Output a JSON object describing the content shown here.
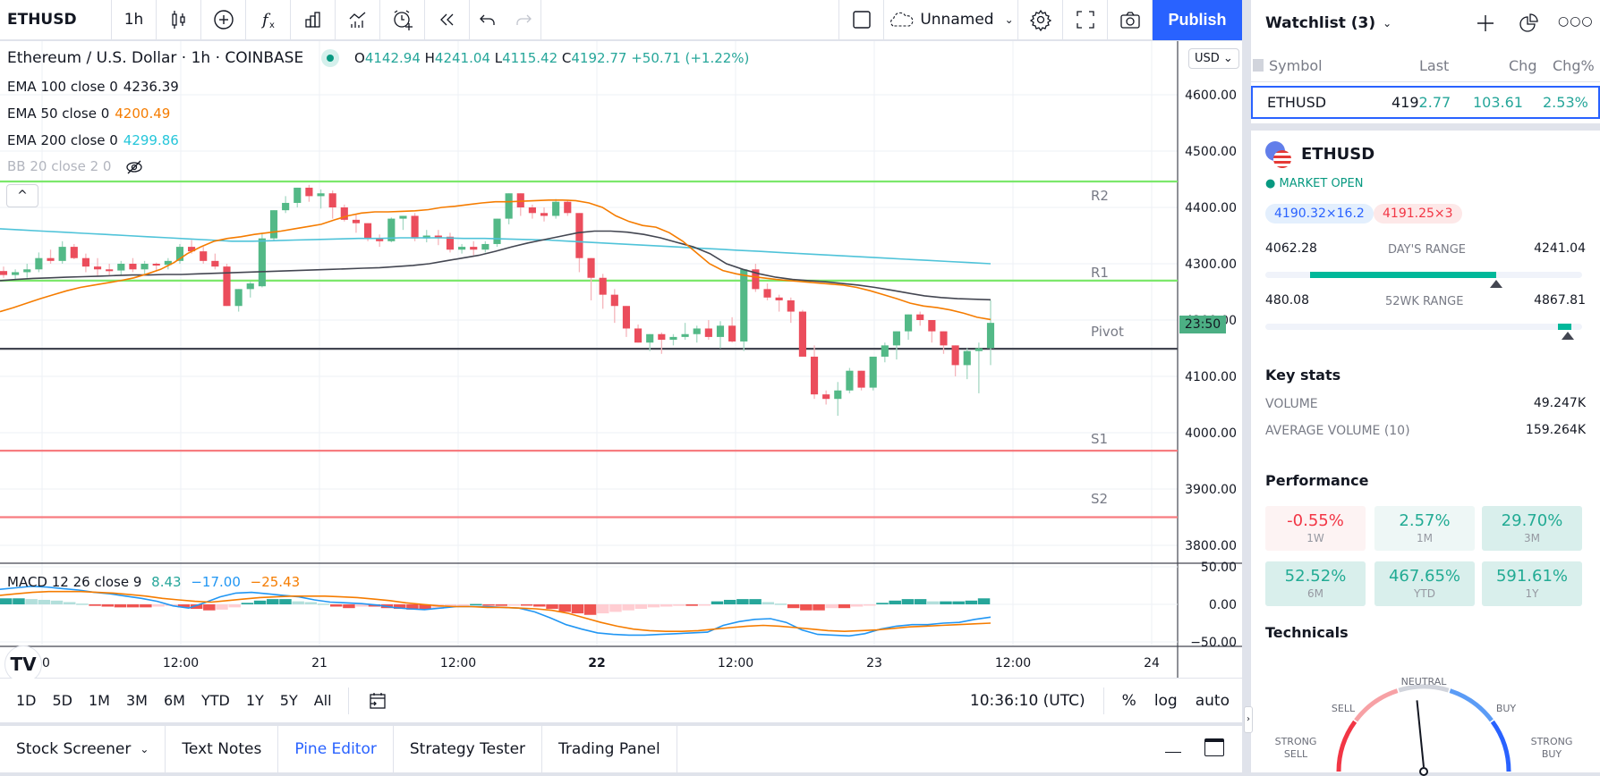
{
  "toolbar": {
    "symbol": "ETHUSD",
    "interval": "1h",
    "layout_name": "Unnamed",
    "publish_label": "Publish"
  },
  "chart": {
    "title": "Ethereum / U.S. Dollar · 1h · COINBASE",
    "ohlc": {
      "o_label": "O",
      "o": "4142.94",
      "h_label": "H",
      "h": "4241.04",
      "l_label": "L",
      "l": "4115.42",
      "c_label": "C",
      "c": "4192.77",
      "change": "+50.71 (+1.22%)"
    },
    "indicators": [
      {
        "label": "EMA 100 close 0",
        "value": "4236.39",
        "color": "#131722"
      },
      {
        "label": "EMA 50 close 0",
        "value": "4200.49",
        "color": "#f57c00"
      },
      {
        "label": "EMA 200 close 0",
        "value": "4299.86",
        "color": "#26c6da"
      },
      {
        "label": "BB 20 close 2 0",
        "value": "",
        "color": "#b2b5be"
      }
    ],
    "currency": "USD",
    "countdown": "23:50",
    "macd_label": "MACD 12 26 close 9",
    "macd_values": [
      "8.43",
      "−17.00",
      "−25.43"
    ],
    "pivots": {
      "R2": 4446,
      "R1": 4270,
      "Pivot": 4149,
      "S1": 3968,
      "S2": 3850
    },
    "pivot_labels": [
      "R2",
      "R1",
      "Pivot",
      "S1",
      "S2"
    ],
    "collapse_icon": "^",
    "logo": "TV"
  },
  "chart_data": {
    "type": "candlestick",
    "title": "Ethereum / U.S. Dollar · 1h · COINBASE",
    "y_ticks": [
      "4600.00",
      "4500.00",
      "4400.00",
      "4300.00",
      "4200.00",
      "4100.00",
      "4000.00",
      "3900.00",
      "3800.00"
    ],
    "ylim": [
      3770,
      4680
    ],
    "x_ticks": [
      "20",
      "12:00",
      "21",
      "12:00",
      "22",
      "12:00",
      "23",
      "12:00",
      "24"
    ],
    "macd_ticks": [
      "50.00",
      "0.00",
      "−50.00"
    ],
    "macd_ylim": [
      -60,
      60
    ],
    "candles": [
      [
        4287,
        4295,
        4275,
        4280
      ],
      [
        4280,
        4290,
        4272,
        4285
      ],
      [
        4285,
        4300,
        4275,
        4290
      ],
      [
        4290,
        4320,
        4285,
        4310
      ],
      [
        4310,
        4325,
        4300,
        4305
      ],
      [
        4305,
        4340,
        4300,
        4330
      ],
      [
        4330,
        4335,
        4308,
        4310
      ],
      [
        4310,
        4318,
        4285,
        4295
      ],
      [
        4295,
        4310,
        4278,
        4290
      ],
      [
        4290,
        4300,
        4280,
        4288
      ],
      [
        4288,
        4305,
        4280,
        4300
      ],
      [
        4300,
        4310,
        4285,
        4290
      ],
      [
        4290,
        4305,
        4282,
        4300
      ],
      [
        4300,
        4302,
        4288,
        4298
      ],
      [
        4298,
        4310,
        4290,
        4305
      ],
      [
        4305,
        4335,
        4300,
        4330
      ],
      [
        4330,
        4342,
        4318,
        4322
      ],
      [
        4322,
        4330,
        4300,
        4305
      ],
      [
        4305,
        4318,
        4290,
        4295
      ],
      [
        4295,
        4300,
        4225,
        4225
      ],
      [
        4225,
        4250,
        4215,
        4255
      ],
      [
        4255,
        4268,
        4240,
        4265
      ],
      [
        4260,
        4355,
        4258,
        4345
      ],
      [
        4345,
        4395,
        4340,
        4395
      ],
      [
        4395,
        4420,
        4390,
        4408
      ],
      [
        4408,
        4428,
        4400,
        4435
      ],
      [
        4435,
        4440,
        4410,
        4420
      ],
      [
        4420,
        4432,
        4398,
        4425
      ],
      [
        4425,
        4430,
        4380,
        4400
      ],
      [
        4400,
        4405,
        4375,
        4378
      ],
      [
        4378,
        4388,
        4355,
        4372
      ],
      [
        4372,
        4365,
        4340,
        4345
      ],
      [
        4345,
        4352,
        4330,
        4340
      ],
      [
        4340,
        4382,
        4338,
        4380
      ],
      [
        4380,
        4385,
        4360,
        4385
      ],
      [
        4385,
        4390,
        4340,
        4345
      ],
      [
        4345,
        4360,
        4338,
        4350
      ],
      [
        4350,
        4360,
        4333,
        4348
      ],
      [
        4348,
        4355,
        4320,
        4325
      ],
      [
        4325,
        4335,
        4318,
        4330
      ],
      [
        4330,
        4340,
        4315,
        4325
      ],
      [
        4325,
        4340,
        4320,
        4335
      ],
      [
        4335,
        4380,
        4330,
        4380
      ],
      [
        4380,
        4425,
        4370,
        4425
      ],
      [
        4425,
        4425,
        4385,
        4400
      ],
      [
        4400,
        4405,
        4380,
        4390
      ],
      [
        4390,
        4400,
        4375,
        4385
      ],
      [
        4385,
        4415,
        4380,
        4410
      ],
      [
        4410,
        4412,
        4385,
        4390
      ],
      [
        4390,
        4365,
        4285,
        4310
      ],
      [
        4310,
        4300,
        4235,
        4275
      ],
      [
        4275,
        4282,
        4220,
        4245
      ],
      [
        4245,
        4255,
        4195,
        4225
      ],
      [
        4225,
        4225,
        4170,
        4185
      ],
      [
        4185,
        4192,
        4160,
        4160
      ],
      [
        4160,
        4175,
        4145,
        4175
      ],
      [
        4175,
        4178,
        4140,
        4165
      ],
      [
        4165,
        4175,
        4155,
        4170
      ],
      [
        4170,
        4195,
        4165,
        4175
      ],
      [
        4175,
        4190,
        4160,
        4185
      ],
      [
        4185,
        4200,
        4165,
        4170
      ],
      [
        4170,
        4198,
        4150,
        4190
      ],
      [
        4190,
        4205,
        4160,
        4162
      ],
      [
        4162,
        4290,
        4145,
        4290
      ],
      [
        4290,
        4300,
        4250,
        4255
      ],
      [
        4255,
        4265,
        4235,
        4240
      ],
      [
        4240,
        4245,
        4215,
        4235
      ],
      [
        4235,
        4240,
        4195,
        4215
      ],
      [
        4215,
        4218,
        4135,
        4135
      ],
      [
        4135,
        4155,
        4060,
        4068
      ],
      [
        4068,
        4075,
        4050,
        4060
      ],
      [
        4060,
        4090,
        4030,
        4075
      ],
      [
        4075,
        4115,
        4070,
        4110
      ],
      [
        4110,
        4110,
        4075,
        4080
      ],
      [
        4080,
        4135,
        4075,
        4135
      ],
      [
        4135,
        4160,
        4125,
        4155
      ],
      [
        4155,
        4175,
        4130,
        4180
      ],
      [
        4180,
        4210,
        4165,
        4210
      ],
      [
        4210,
        4215,
        4190,
        4200
      ],
      [
        4200,
        4188,
        4160,
        4180
      ],
      [
        4180,
        4178,
        4140,
        4155
      ],
      [
        4155,
        4148,
        4100,
        4120
      ],
      [
        4120,
        4150,
        4095,
        4145
      ],
      [
        4145,
        4160,
        4070,
        4150
      ],
      [
        4150,
        4235,
        4120,
        4195
      ]
    ],
    "ema50": [
      4215,
      4222,
      4230,
      4238,
      4245,
      4252,
      4258,
      4262,
      4266,
      4270,
      4275,
      4282,
      4290,
      4302,
      4318,
      4330,
      4340,
      4345,
      4348,
      4352,
      4355,
      4358,
      4362,
      4366,
      4370,
      4378,
      4385,
      4390,
      4392,
      4392,
      4393,
      4394,
      4396,
      4400,
      4402,
      4405,
      4408,
      4410,
      4410,
      4411,
      4412,
      4413,
      4413,
      4412,
      4408,
      4400,
      4385,
      4375,
      4368,
      4365,
      4355,
      4340,
      4320,
      4300,
      4288,
      4282,
      4278,
      4275,
      4272,
      4270,
      4268,
      4266,
      4264,
      4262,
      4258,
      4252,
      4245,
      4238,
      4230,
      4225,
      4222,
      4218,
      4212,
      4205,
      4201
    ],
    "ema100": [
      4270,
      4272,
      4274,
      4275,
      4276,
      4277,
      4278,
      4279,
      4280,
      4280,
      4281,
      4281,
      4282,
      4283,
      4284,
      4285,
      4286,
      4287,
      4288,
      4289,
      4290,
      4291,
      4292,
      4293,
      4295,
      4297,
      4300,
      4305,
      4310,
      4315,
      4322,
      4330,
      4337,
      4343,
      4349,
      4355,
      4358,
      4358,
      4356,
      4352,
      4346,
      4338,
      4330,
      4318,
      4300,
      4290,
      4282,
      4276,
      4272,
      4270,
      4268,
      4265,
      4262,
      4258,
      4253,
      4248,
      4243,
      4240,
      4238,
      4237,
      4236
    ],
    "ema200": [
      4362,
      4360,
      4358,
      4356,
      4354,
      4352,
      4350,
      4348,
      4346,
      4344,
      4342,
      4340,
      4340,
      4341,
      4342,
      4343,
      4344,
      4345,
      4345,
      4346,
      4346,
      4346,
      4345,
      4345,
      4344,
      4343,
      4342,
      4340,
      4338,
      4336,
      4334,
      4332,
      4330,
      4328,
      4326,
      4324,
      4322,
      4320,
      4318,
      4316,
      4314,
      4312,
      4310,
      4308,
      4306,
      4304,
      4302,
      4300
    ],
    "macd_hist": [
      8,
      8,
      7,
      6,
      5,
      3,
      1,
      -2,
      -3,
      -4,
      -4,
      -4,
      -3,
      -2,
      -4,
      -6,
      -8,
      -7,
      -4,
      2,
      5,
      7,
      7,
      4,
      3,
      1,
      -3,
      -5,
      -3,
      -3,
      -5,
      -6,
      -7,
      -7,
      -6,
      -3,
      -1,
      0.5,
      -1,
      -2,
      -1,
      -1,
      -3,
      -6,
      -10,
      -12,
      -14,
      -12,
      -10,
      -8,
      -6,
      -4,
      -3,
      -2,
      -2,
      -1,
      4,
      6,
      7,
      7,
      3,
      1,
      -5,
      -8,
      -8,
      -5,
      -5,
      -3,
      -1,
      2,
      5,
      7,
      7,
      4,
      4,
      4,
      5,
      8
    ],
    "macd_line": [
      20,
      22,
      24,
      23,
      21,
      19,
      16,
      14,
      11,
      8,
      4,
      -2,
      -5,
      2,
      10,
      15,
      16,
      14,
      12,
      10,
      6,
      3,
      2,
      1,
      -1,
      -4,
      -6,
      -7,
      -5,
      -3,
      -3,
      -3,
      -4,
      -5,
      -10,
      -18,
      -27,
      -33,
      -38,
      -40,
      -41,
      -41,
      -40,
      -39,
      -38,
      -37,
      -28,
      -23,
      -20,
      -19,
      -24,
      -34,
      -40,
      -41,
      -42,
      -39,
      -33,
      -29,
      -27,
      -27,
      -25,
      -24,
      -20,
      -17
    ],
    "signal_line": [
      12,
      14,
      16,
      17,
      17,
      17,
      16,
      15,
      13,
      11,
      8,
      6,
      4,
      3,
      5,
      7,
      9,
      10,
      11,
      11,
      11,
      10,
      9,
      7,
      5,
      2,
      0,
      -2,
      -3,
      -3,
      -4,
      -4,
      -5,
      -6,
      -8,
      -12,
      -18,
      -24,
      -29,
      -33,
      -35,
      -36,
      -36,
      -35,
      -33,
      -31,
      -29,
      -28,
      -29,
      -31,
      -33,
      -35,
      -36,
      -35,
      -34,
      -32,
      -30,
      -29,
      -28,
      -27,
      -26,
      -25
    ]
  },
  "bottom_bar": {
    "ranges": [
      "1D",
      "5D",
      "1M",
      "3M",
      "6M",
      "YTD",
      "1Y",
      "5Y",
      "All"
    ],
    "time": "10:36:10 (UTC)",
    "percent": "%",
    "log": "log",
    "auto": "auto"
  },
  "bottom_tabs": [
    "Stock Screener",
    "Text Notes",
    "Pine Editor",
    "Strategy Tester",
    "Trading Panel"
  ],
  "watchlist": {
    "title": "Watchlist (3)",
    "columns": [
      "Symbol",
      "Last",
      "Chg",
      "Chg%"
    ],
    "row": {
      "symbol": "ETHUSD",
      "last_a": "419",
      "last_b": "2.77",
      "chg": "103.61",
      "chgp": "2.53%"
    }
  },
  "details": {
    "symbol": "ETHUSD",
    "status": "MARKET OPEN",
    "bid": "4190.32×16.2",
    "ask": "4191.25×3",
    "day_low": "4062.28",
    "day_label": "DAY'S RANGE",
    "day_high": "4241.04",
    "day_position": 0.73,
    "wk_low": "480.08",
    "wk_label": "52WK RANGE",
    "wk_high": "4867.81",
    "wk_position": 0.955,
    "key_stats_title": "Key stats",
    "stats": [
      {
        "label": "VOLUME",
        "value": "49.247K"
      },
      {
        "label": "AVERAGE VOLUME (10)",
        "value": "159.264K"
      }
    ],
    "performance_title": "Performance",
    "performance": [
      {
        "value": "-0.55%",
        "period": "1W",
        "dir": "down"
      },
      {
        "value": "2.57%",
        "period": "1M",
        "dir": "up"
      },
      {
        "value": "29.70%",
        "period": "3M",
        "dir": "up"
      },
      {
        "value": "52.52%",
        "period": "6M",
        "dir": "up"
      },
      {
        "value": "467.65%",
        "period": "YTD",
        "dir": "up"
      },
      {
        "value": "591.61%",
        "period": "1Y",
        "dir": "up"
      }
    ],
    "technicals_title": "Technicals",
    "gauge_labels": {
      "strong_sell": "STRONG SELL",
      "sell": "SELL",
      "neutral": "NEUTRAL",
      "buy": "BUY",
      "strong_buy": "STRONG BUY"
    },
    "gauge_value": 0.47
  },
  "colors": {
    "up": "#26a69a",
    "down": "#ef5350",
    "candle_up": "#53b987",
    "candle_down": "#eb4d5c",
    "accent": "#2962ff"
  }
}
